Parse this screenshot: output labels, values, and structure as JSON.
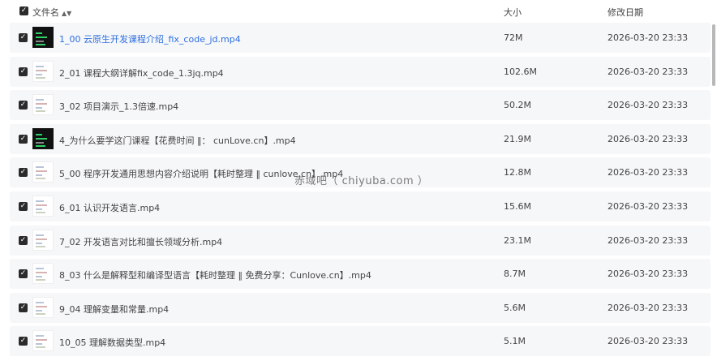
{
  "header": {
    "name_label": "文件名",
    "sort_icon": "sort-arrows-icon",
    "size_label": "大小",
    "date_label": "修改日期"
  },
  "files": [
    {
      "name": "1_00 云原生开发课程介绍_fix_code_jd.mp4",
      "size": "72M",
      "date": "2026-03-20 23:33",
      "thumb": "dark-video-thumbnail",
      "checked": true
    },
    {
      "name": "2_01 课程大纲详解fix_code_1.3jq.mp4",
      "size": "102.6M",
      "date": "2026-03-20 23:33",
      "thumb": "light-video-thumbnail",
      "checked": true
    },
    {
      "name": "3_02 项目演示_1.3倍速.mp4",
      "size": "50.2M",
      "date": "2026-03-20 23:33",
      "thumb": "light-video-thumbnail",
      "checked": true
    },
    {
      "name": "4_为什么要学这门课程【花费时间 ‖： cunLove.cn】.mp4",
      "size": "21.9M",
      "date": "2026-03-20 23:33",
      "thumb": "dark-video-thumbnail",
      "checked": true
    },
    {
      "name": "5_00 程序开发通用思想内容介绍说明【耗时整理 ‖ cunlove.cn】.mp4",
      "size": "12.8M",
      "date": "2026-03-20 23:33",
      "thumb": "light-video-thumbnail",
      "checked": true
    },
    {
      "name": "6_01 认识开发语言.mp4",
      "size": "15.6M",
      "date": "2026-03-20 23:33",
      "thumb": "light-video-thumbnail",
      "checked": true
    },
    {
      "name": "7_02 开发语言对比和擅长领域分析.mp4",
      "size": "23.1M",
      "date": "2026-03-20 23:33",
      "thumb": "light-video-thumbnail",
      "checked": true
    },
    {
      "name": "8_03 什么是解释型和编译型语言【耗时整理 ‖ 免费分享：Cunlove.cn】.mp4",
      "size": "8.7M",
      "date": "2026-03-20 23:33",
      "thumb": "light-video-thumbnail",
      "checked": true
    },
    {
      "name": "9_04 理解变量和常量.mp4",
      "size": "5.6M",
      "date": "2026-03-20 23:33",
      "thumb": "light-video-thumbnail",
      "checked": true
    },
    {
      "name": "10_05 理解数据类型.mp4",
      "size": "5.1M",
      "date": "2026-03-20 23:33",
      "thumb": "light-video-thumbnail",
      "checked": true
    }
  ],
  "watermark": "赤域吧（ chiyuba.com ）",
  "colors": {
    "link_blue": "#2f6fe0",
    "row_bg": "#f6f7f9",
    "checkbox": "#2b2b2b"
  }
}
